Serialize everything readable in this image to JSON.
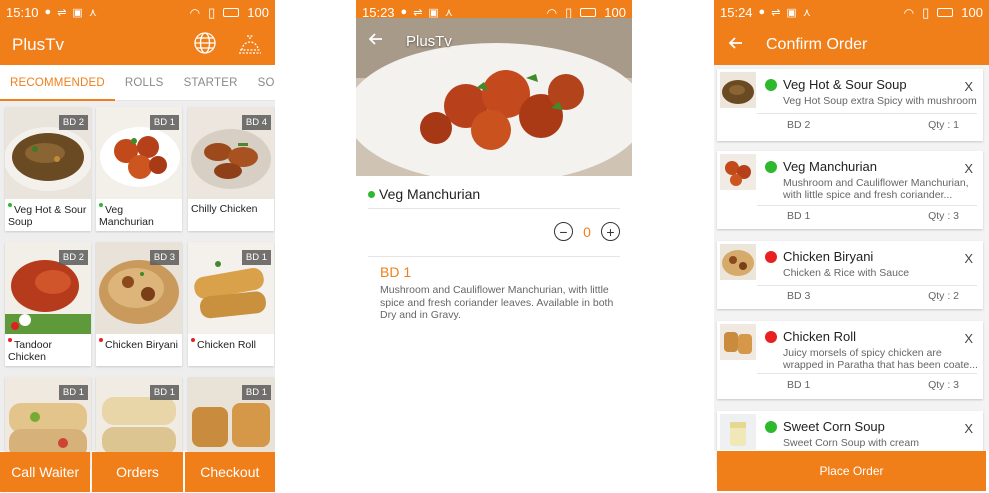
{
  "status_bars": [
    {
      "time": "15:10",
      "battery": "100"
    },
    {
      "time": "15:23",
      "battery": "100"
    },
    {
      "time": "15:24",
      "battery": "100"
    }
  ],
  "screen1": {
    "app_title": "PlusTv",
    "tabs": [
      {
        "label": "RECOMMENDED",
        "active": true
      },
      {
        "label": "ROLLS",
        "active": false
      },
      {
        "label": "STARTER",
        "active": false
      },
      {
        "label": "SOUPS",
        "active": false
      }
    ],
    "menu_items": [
      {
        "name": "Veg Hot & Sour Soup",
        "badge": "BD 2",
        "veg": true
      },
      {
        "name": "Veg Manchurian",
        "badge": "BD 1",
        "veg": true
      },
      {
        "name": "Chilly Chicken",
        "badge": "BD 4",
        "veg": false
      },
      {
        "name": "Tandoor Chicken",
        "badge": "BD 2",
        "veg": false
      },
      {
        "name": "Chicken Biryani",
        "badge": "BD 3",
        "veg": false
      },
      {
        "name": "Chicken Roll",
        "badge": "BD 1",
        "veg": false
      },
      {
        "name": "",
        "badge": "BD 1",
        "veg": false
      },
      {
        "name": "",
        "badge": "BD 1",
        "veg": false
      },
      {
        "name": "",
        "badge": "BD 1",
        "veg": false
      }
    ],
    "bottom_buttons": [
      "Call Waiter",
      "Orders",
      "Checkout"
    ]
  },
  "screen2": {
    "app_title": "PlusTv",
    "item_name": "Veg Manchurian",
    "quantity": "0",
    "price": "BD 1",
    "description": "Mushroom and Cauliflower Manchurian, with little spice and fresh coriander leaves. Available in both Dry and in Gravy."
  },
  "screen3": {
    "title": "Confirm Order",
    "orders": [
      {
        "name": "Veg Hot & Sour Soup",
        "desc": "Veg Hot Soup extra Spicy with mushroom",
        "price": "BD 2",
        "qty": "Qty : 1",
        "status": "green",
        "close": "X"
      },
      {
        "name": "Veg Manchurian",
        "desc": "Mushroom and Cauliflower Manchurian, with little spice and fresh coriander...",
        "price": "BD 1",
        "qty": "Qty : 3",
        "status": "green",
        "close": "X"
      },
      {
        "name": "Chicken Biryani",
        "desc": "Chicken & Rice with Sauce",
        "price": "BD 3",
        "qty": "Qty : 2",
        "status": "red",
        "close": "X"
      },
      {
        "name": "Chicken Roll",
        "desc": "Juicy morsels of spicy chicken are wrapped in Paratha that has been coate...",
        "price": "BD 1",
        "qty": "Qty : 3",
        "status": "red",
        "close": "X"
      },
      {
        "name": "Sweet Corn Soup",
        "desc": "Sweet Corn Soup with cream",
        "price": "",
        "qty": "",
        "status": "green",
        "close": "X"
      }
    ],
    "place_order": "Place Order"
  },
  "colors": {
    "accent": "#f07f1a",
    "veg": "#2eb82e",
    "nonveg": "#e82020"
  }
}
